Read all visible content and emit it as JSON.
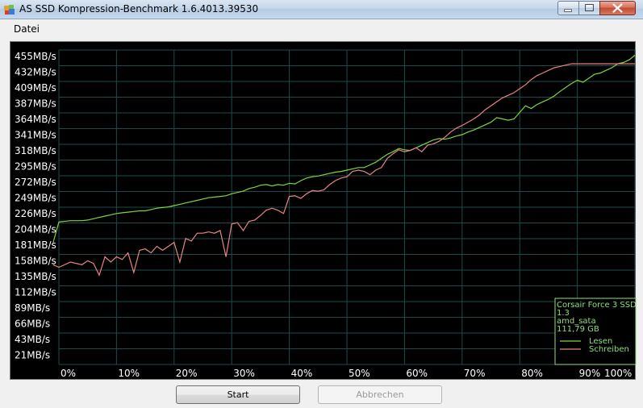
{
  "window": {
    "title": "AS SSD Kompression-Benchmark 1.6.4013.39530",
    "controls": [
      "minimize-icon",
      "maximize-icon",
      "close-icon"
    ]
  },
  "menu": {
    "items": [
      "Datei"
    ]
  },
  "buttons": {
    "start": "Start",
    "abort": "Abbrechen"
  },
  "legend": {
    "device": "Corsair Force 3 SSD",
    "firmware": "1.3",
    "driver": "amd_sata",
    "capacity": "111,79 GB",
    "read_label": "Lesen",
    "write_label": "Schreiben"
  },
  "colors": {
    "background": "#000000",
    "grid": "#1f4a4a",
    "axis_text": "#ffffff",
    "read": "#7cd83a",
    "write": "#e88484",
    "legend_text": "#8fe07a"
  },
  "chart_data": {
    "type": "line",
    "ylabel": "",
    "xlabel": "",
    "y_ticks": [
      "455MB/s",
      "432MB/s",
      "409MB/s",
      "387MB/s",
      "364MB/s",
      "341MB/s",
      "318MB/s",
      "295MB/s",
      "272MB/s",
      "249MB/s",
      "226MB/s",
      "204MB/s",
      "181MB/s",
      "158MB/s",
      "135MB/s",
      "112MB/s",
      "89MB/s",
      "66MB/s",
      "43MB/s",
      "21MB/s"
    ],
    "x_ticks": [
      "0%",
      "10%",
      "20%",
      "30%",
      "40%",
      "50%",
      "60%",
      "70%",
      "80%",
      "90%",
      "100%"
    ],
    "xlim": [
      0,
      100
    ],
    "ylim": [
      0,
      455
    ],
    "grid": true,
    "legend_position": "bottom-right",
    "series": [
      {
        "name": "Lesen",
        "x": [
          -1,
          0,
          2,
          4,
          5,
          6,
          7,
          8,
          9,
          10,
          11,
          12,
          13,
          14,
          15,
          16,
          17,
          18,
          19,
          20,
          21,
          22,
          23,
          24,
          25,
          26,
          27,
          28,
          29,
          30,
          31,
          32,
          33,
          34,
          35,
          36,
          37,
          38,
          39,
          40,
          41,
          42,
          43,
          44,
          45,
          46,
          47,
          48,
          49,
          50,
          51,
          52,
          53,
          54,
          55,
          56,
          57,
          58,
          59,
          60,
          61,
          62,
          63,
          64,
          65,
          66,
          67,
          68,
          69,
          70,
          71,
          72,
          73,
          74,
          75,
          76,
          77,
          78,
          79,
          80,
          81,
          82,
          83,
          84,
          85,
          86,
          87,
          88,
          89,
          90,
          91,
          92,
          93,
          94,
          95,
          96,
          97,
          98,
          99,
          100
        ],
        "values": [
          162,
          193,
          195,
          195,
          196,
          198,
          200,
          202,
          204,
          206,
          207,
          208,
          209,
          210,
          210,
          212,
          214,
          215,
          216,
          218,
          220,
          222,
          224,
          226,
          228,
          230,
          231,
          232,
          233,
          236,
          238,
          240,
          244,
          246,
          249,
          250,
          248,
          250,
          249,
          252,
          251,
          256,
          260,
          262,
          263,
          265,
          267,
          269,
          270,
          272,
          274,
          276,
          276,
          280,
          284,
          290,
          296,
          300,
          305,
          303,
          302,
          306,
          310,
          314,
          318,
          320,
          319,
          321,
          324,
          326,
          330,
          333,
          337,
          341,
          345,
          352,
          350,
          348,
          350,
          360,
          370,
          366,
          372,
          376,
          380,
          385,
          392,
          398,
          404,
          409,
          406,
          412,
          418,
          420,
          424,
          428,
          434,
          436,
          440,
          447
        ]
      },
      {
        "name": "Schreiben",
        "x": [
          -1,
          0,
          2,
          4,
          5,
          6,
          7,
          8,
          9,
          10,
          11,
          12,
          13,
          14,
          15,
          16,
          17,
          18,
          19,
          20,
          21,
          22,
          23,
          24,
          25,
          26,
          27,
          28,
          29,
          30,
          31,
          32,
          33,
          34,
          35,
          36,
          37,
          38,
          39,
          40,
          41,
          42,
          43,
          44,
          45,
          46,
          47,
          48,
          49,
          50,
          51,
          52,
          53,
          54,
          55,
          56,
          57,
          58,
          59,
          60,
          61,
          62,
          63,
          64,
          65,
          66,
          67,
          68,
          69,
          70,
          71,
          72,
          73,
          74,
          75,
          76,
          77,
          78,
          79,
          80,
          81,
          82,
          83,
          84,
          85,
          86,
          87,
          88,
          89,
          90,
          91,
          92,
          93,
          94,
          95,
          96,
          97,
          98,
          99,
          100
        ],
        "values": [
          128,
          124,
          132,
          128,
          134,
          130,
          112,
          140,
          132,
          140,
          136,
          146,
          116,
          150,
          152,
          146,
          156,
          150,
          156,
          162,
          132,
          168,
          164,
          176,
          176,
          178,
          176,
          180,
          140,
          190,
          192,
          180,
          194,
          196,
          203,
          211,
          214,
          211,
          206,
          232,
          233,
          229,
          236,
          241,
          240,
          242,
          250,
          256,
          260,
          262,
          270,
          272,
          270,
          265,
          272,
          276,
          290,
          297,
          303,
          300,
          302,
          306,
          300,
          310,
          312,
          316,
          322,
          330,
          336,
          340,
          345,
          350,
          356,
          364,
          370,
          376,
          382,
          386,
          390,
          396,
          402,
          410,
          416,
          420,
          424,
          428,
          430,
          432,
          434,
          434,
          434,
          434,
          434,
          434,
          434,
          434,
          434,
          434,
          434,
          434
        ]
      }
    ]
  }
}
